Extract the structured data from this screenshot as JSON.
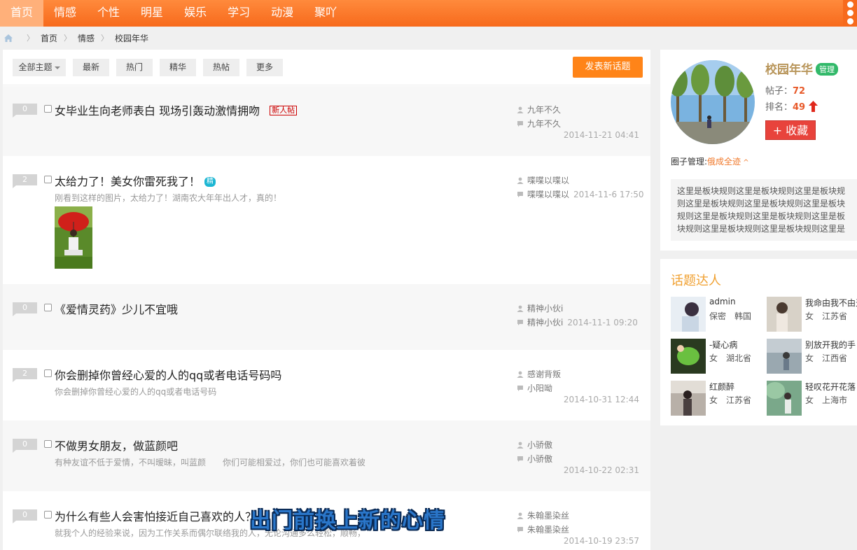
{
  "nav": {
    "items": [
      {
        "label": "首页",
        "active": true
      },
      {
        "label": "情感"
      },
      {
        "label": "个性"
      },
      {
        "label": "明星"
      },
      {
        "label": "娱乐"
      },
      {
        "label": "学习"
      },
      {
        "label": "动漫"
      },
      {
        "label": "聚吖"
      }
    ]
  },
  "breadcrumb": {
    "home": "首页",
    "level1": "情感",
    "current": "校园年华"
  },
  "toolbar": {
    "filter_all": "全部主题",
    "latest": "最新",
    "hot": "热门",
    "best": "精华",
    "hot_posts": "热帖",
    "more": "更多",
    "post_button": "发表新话题"
  },
  "posts": [
    {
      "count": "0",
      "title": "女毕业生向老师表白 现场引轰动激情拥吻",
      "badge_new": "新人帖",
      "author": "九年不久",
      "last_reply": "九年不久",
      "date": "2014-11-21 04:41"
    },
    {
      "count": "2",
      "title": "太给力了！美女你雷死我了！",
      "badge_best": "精",
      "excerpt": "刚看到这样的图片，太给力了！湖南农大年年出人才，真的！",
      "author": "喋喋以喋以",
      "last_reply": "喋喋以喋以",
      "date": "2014-11-6 17:50"
    },
    {
      "count": "0",
      "title": "《爱情灵药》少儿不宜哦",
      "author": "精神小伙i",
      "last_reply": "精神小伙i",
      "date": "2014-11-1 09:20"
    },
    {
      "count": "2",
      "title": "你会删掉你曾经心爱的人的qq或者电话号码吗",
      "excerpt": "你会删掉你曾经心爱的人的qq或者电话号码",
      "author": "感谢背叛",
      "last_reply": "小阳呦",
      "date": "2014-10-31 12:44"
    },
    {
      "count": "0",
      "title": "不做男女朋友，做蓝颜吧",
      "excerpt": "有种友谊不低于爱情，不叫暧昧，叫蓝颜　　你们可能相爱过，你们也可能喜欢着彼",
      "author": "小骄傲",
      "last_reply": "小骄傲",
      "date": "2014-10-22 02:31"
    },
    {
      "count": "0",
      "title": "为什么有些人会害怕接近自己喜欢的人？",
      "excerpt": "就我个人的经验来说，因为工作关系而偶尔联络我的人，无论沟通多么轻松，顺畅，",
      "author": "朱翰墨染丝",
      "last_reply": "朱翰墨染丝",
      "date": "2014-10-19 23:57"
    }
  ],
  "overlay_caption": "出门前换上新的心情",
  "sidebar": {
    "name": "校园年华",
    "admin_badge": "管理",
    "posts_label": "帖子：",
    "posts_value": "72",
    "rank_label": "排名：",
    "rank_value": "49",
    "fav_button": "+ 收藏",
    "manager_label": "圈子管理:",
    "manager_name": "俄成全迹",
    "rules": "这里是板块规则这里是板块规则这里是板块规则这里是板块规则这里是板块规则这里是板块规则这里是板块规则这里是板块规则这里是板块规则这里是板块规则这里是板块规则这里是"
  },
  "experts": {
    "title": "话题达人",
    "list": [
      {
        "name": "admin",
        "gender": "保密",
        "region": "韩国"
      },
      {
        "name": "我命由我不由天",
        "gender": "女",
        "region": "江苏省"
      },
      {
        "name": "-疑心病",
        "gender": "女",
        "region": "湖北省"
      },
      {
        "name": "别放开我的手",
        "gender": "女",
        "region": "江西省"
      },
      {
        "name": "红颜醉",
        "gender": "女",
        "region": "江苏省"
      },
      {
        "name": "轻叹花开花落",
        "gender": "女",
        "region": "上海市"
      }
    ]
  },
  "colors": {
    "accent": "#f76a1c",
    "admin_green": "#32b96a",
    "fav_red": "#e8433c",
    "expert_title": "#f0a030"
  }
}
